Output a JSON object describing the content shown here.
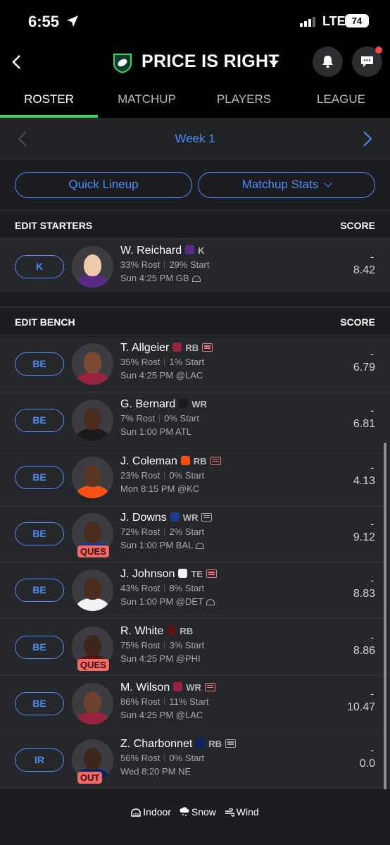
{
  "status_bar": {
    "time": "6:55",
    "network": "LTE",
    "battery": "74"
  },
  "header": {
    "league_name": "PRICE IS RIGHT"
  },
  "tabs": [
    {
      "label": "ROSTER",
      "active": true
    },
    {
      "label": "MATCHUP",
      "active": false
    },
    {
      "label": "PLAYERS",
      "active": false
    },
    {
      "label": "LEAGUE",
      "active": false
    }
  ],
  "week": {
    "label": "Week 1"
  },
  "actions": {
    "quick_lineup": "Quick Lineup",
    "matchup_stats": "Matchup Stats"
  },
  "starters": {
    "heading": "EDIT STARTERS",
    "score_heading": "SCORE",
    "players": [
      {
        "slot": "K",
        "name": "W. Reichard",
        "pos": "K",
        "rost": "33% Rost",
        "start": "29% Start",
        "game": "Sun 4:25 PM GB",
        "dash": "-",
        "score": "8.42",
        "team_color": "#5b2a86",
        "skin": "#f0c9a8",
        "news": "",
        "dome": true,
        "tag": ""
      }
    ]
  },
  "bench": {
    "heading": "EDIT BENCH",
    "score_heading": "SCORE",
    "players": [
      {
        "slot": "BE",
        "name": "T. Allgeier",
        "pos": "RB",
        "rost": "35% Rost",
        "start": "1% Start",
        "game": "Sun 4:25 PM @LAC",
        "dash": "-",
        "score": "6.79",
        "team_color": "#97233f",
        "skin": "#7a4a32",
        "news": "hot",
        "dome": false,
        "tag": ""
      },
      {
        "slot": "BE",
        "name": "G. Bernard",
        "pos": "WR",
        "rost": "7% Rost",
        "start": "0% Start",
        "game": "Sun 1:00 PM ATL",
        "dash": "-",
        "score": "6.81",
        "team_color": "#1a1a1a",
        "skin": "#4a2c1d",
        "news": "",
        "dome": false,
        "tag": ""
      },
      {
        "slot": "BE",
        "name": "J. Coleman",
        "pos": "RB",
        "rost": "23% Rost",
        "start": "0% Start",
        "game": "Mon 8:15 PM @KC",
        "dash": "-",
        "score": "4.13",
        "team_color": "#fb4f14",
        "skin": "#5a3522",
        "news": "hot",
        "dome": false,
        "tag": ""
      },
      {
        "slot": "BE",
        "name": "J. Downs",
        "pos": "WR",
        "rost": "72% Rost",
        "start": "2% Start",
        "game": "Sun 1:00 PM BAL",
        "dash": "-",
        "score": "9.12",
        "team_color": "#1e3a8a",
        "skin": "#4a2c1d",
        "news": "cold",
        "dome": true,
        "tag": "QUES"
      },
      {
        "slot": "BE",
        "name": "J. Johnson",
        "pos": "TE",
        "rost": "43% Rost",
        "start": "8% Start",
        "game": "Sun 1:00 PM @DET",
        "dash": "-",
        "score": "8.83",
        "team_color": "#f2f2f2",
        "skin": "#4a2c1d",
        "news": "hot",
        "dome": true,
        "tag": ""
      },
      {
        "slot": "BE",
        "name": "R. White",
        "pos": "RB",
        "rost": "75% Rost",
        "start": "3% Start",
        "game": "Sun 4:25 PM @PHI",
        "dash": "-",
        "score": "8.86",
        "team_color": "#5a1414",
        "skin": "#3f261a",
        "news": "",
        "dome": false,
        "tag": "QUES"
      },
      {
        "slot": "BE",
        "name": "M. Wilson",
        "pos": "WR",
        "rost": "86% Rost",
        "start": "11% Start",
        "game": "Sun 4:25 PM @LAC",
        "dash": "-",
        "score": "10.47",
        "team_color": "#97233f",
        "skin": "#6b4330",
        "news": "hot",
        "dome": false,
        "tag": ""
      },
      {
        "slot": "IR",
        "name": "Z. Charbonnet",
        "pos": "RB",
        "rost": "56% Rost",
        "start": "0% Start",
        "game": "Wed 8:20 PM NE",
        "dash": "-",
        "score": "0.0",
        "team_color": "#0b2265",
        "skin": "#3f261a",
        "news": "cold",
        "dome": false,
        "tag": "OUT"
      }
    ]
  },
  "legend": {
    "indoor": "Indoor",
    "snow": "Snow",
    "wind": "Wind"
  },
  "colors": {
    "accent": "#4d8df7",
    "tab_underline": "#35d85a",
    "status_red": "#f26b6b"
  }
}
